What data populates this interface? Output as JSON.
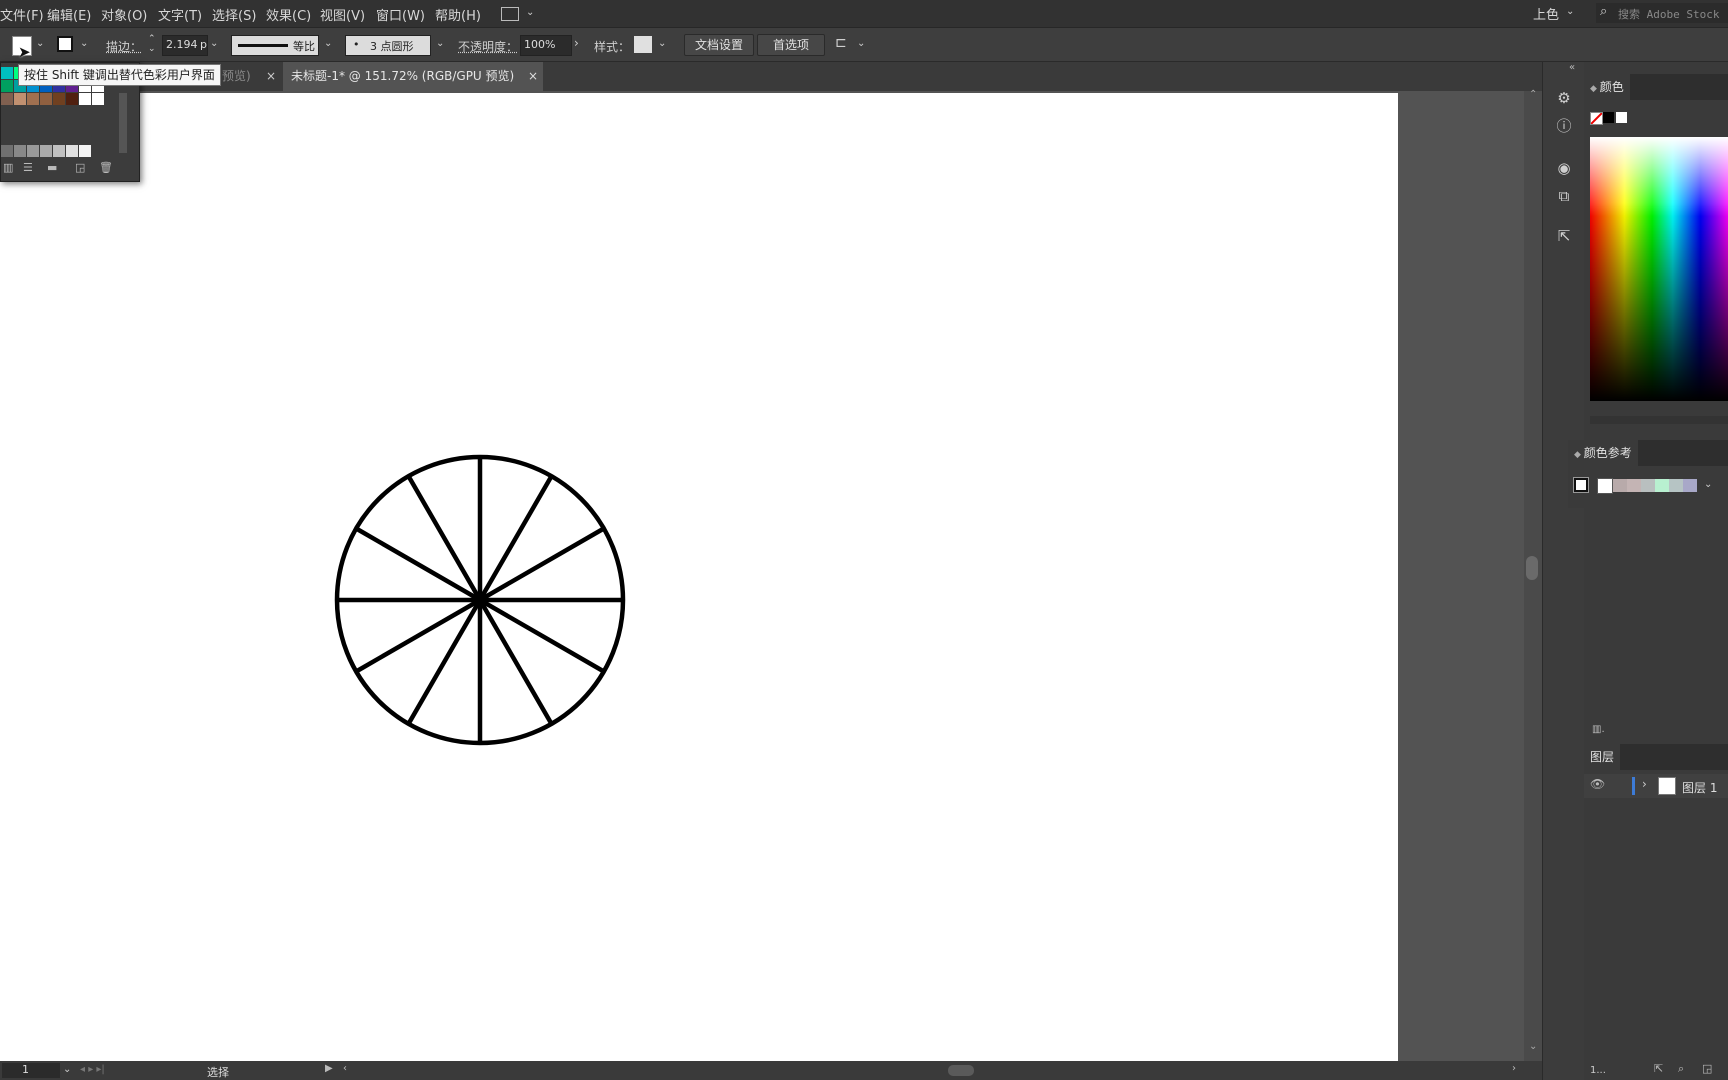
{
  "menu": {
    "items": [
      "文件(F)",
      "编辑(E)",
      "对象(O)",
      "文字(T)",
      "选择(S)",
      "效果(C)",
      "视图(V)",
      "窗口(W)",
      "帮助(H)"
    ],
    "workspace": "上色",
    "search_placeholder": "搜索 Adobe Stock"
  },
  "control": {
    "stroke_label": "描边：",
    "stroke_weight": "2.194",
    "stroke_unit": "p",
    "profile_label": "等比",
    "brush_label": "3 点圆形",
    "brush_dot": "•",
    "opacity_label": "不透明度：",
    "opacity_value": "100%",
    "style_label": "样式：",
    "doc_setup_button": "文档设置",
    "preferences_button": "首选项"
  },
  "tooltip": "按住 Shift 键调出替代色彩用户界面",
  "tabs": [
    {
      "label": "预览)",
      "active": false
    },
    {
      "label": "未标题-1* @ 151.72% (RGB/GPU 预览)",
      "active": true
    }
  ],
  "tab_close": "×",
  "status": {
    "zoom": "1",
    "tool": "选择"
  },
  "panels": {
    "color": {
      "title": "颜色"
    },
    "color_guide": {
      "title": "颜色参考"
    },
    "layers": {
      "title": "图层",
      "layer_name": "图层 1"
    },
    "bottom_label": "1..."
  },
  "colors": {
    "accent": "#3d7bd6",
    "stroke": "#000000"
  }
}
